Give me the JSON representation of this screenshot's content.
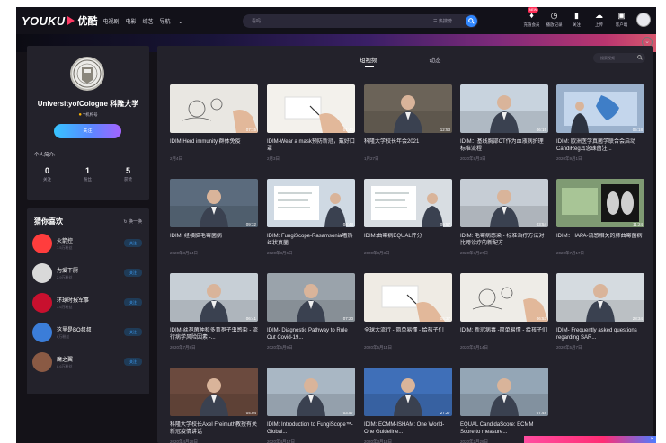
{
  "header": {
    "logo_text": "YOUKU",
    "logo_cn": "优酷",
    "nav": [
      "电视剧",
      "电影",
      "综艺",
      "导航"
    ],
    "search_placeholder": "看吗",
    "hot_label": "热搜榜",
    "icons": [
      {
        "icon": "vip-diamond-icon",
        "label": "充值会员",
        "badge": "NEW"
      },
      {
        "icon": "history-clock-icon",
        "label": "播放记录"
      },
      {
        "icon": "bookmark-icon",
        "label": "关注"
      },
      {
        "icon": "upload-cloud-icon",
        "label": "上传"
      },
      {
        "icon": "client-monitor-icon",
        "label": "客户端"
      }
    ]
  },
  "profile": {
    "name": "UniversityofCologne 科隆大学",
    "auth": "Y机构号",
    "follow_label": "关注",
    "intro_label": "个人简介:",
    "stats": [
      {
        "value": "0",
        "label": "关注"
      },
      {
        "value": "1",
        "label": "粉丝"
      },
      {
        "value": "5",
        "label": "获赞"
      }
    ]
  },
  "recommend": {
    "title": "猜你喜欢",
    "refresh": "换一换",
    "items": [
      {
        "name": "火箭控",
        "sub": "7.5万粉丝",
        "btn": "关注",
        "color": "#ff3d3d"
      },
      {
        "name": "为爱下厨",
        "sub": "2.9万粉丝",
        "btn": "关注",
        "color": "#d9d9d9"
      },
      {
        "name": "环球时报军事",
        "sub": "3.6万粉丝",
        "btn": "关注",
        "color": "#c8102e"
      },
      {
        "name": "这里是BO叔叔",
        "sub": "6万粉丝",
        "btn": "关注",
        "color": "#3b7dd8"
      },
      {
        "name": "魔之翼",
        "sub": "8.6万粉丝",
        "btn": "关注",
        "color": "#8a5a44"
      }
    ]
  },
  "main": {
    "tabs": [
      "短视频",
      "动态"
    ],
    "search_placeholder": "搜索视频",
    "videos": [
      {
        "title": "IDIM Herd immunity 群体免疫",
        "date": "2月4日",
        "dur": "07:15",
        "bg": "#e9e7e2",
        "kind": "drawing"
      },
      {
        "title": "IDIM-Wear a mask预防新冠，戴好口罩",
        "date": "2月3日",
        "dur": "01:40",
        "bg": "#f3f1ec",
        "kind": "hand"
      },
      {
        "title": "科隆大学校长年会2021",
        "date": "1月27日",
        "dur": "12:53",
        "bg": "#6b6358",
        "kind": "person"
      },
      {
        "title": "IDIM：基线胸部CT作为血液病护理标准流程",
        "date": "2020年9月3日",
        "dur": "06:15",
        "bg": "#c8d3de",
        "kind": "person"
      },
      {
        "title": "IDIM: 欧洲医学真菌学联合会启动CandiReg耳念珠菌注...",
        "date": "2020年9月1日",
        "dur": "05:18",
        "bg": "#9bb1cc",
        "kind": "map"
      },
      {
        "title": "IDIM: 经横脑毛霉菌病",
        "date": "2020年8月24日",
        "dur": "09:32",
        "bg": "#5b6b7d",
        "kind": "person"
      },
      {
        "title": "IDIM: FungiScope-Rasamsonia嗜热丝状真菌...",
        "date": "2020年8月6日",
        "dur": "04:48",
        "bg": "#cfd9e3",
        "kind": "slide"
      },
      {
        "title": "IDIM:曲霉病EQUAL评分",
        "date": "2020年8月3日",
        "dur": "09:57",
        "bg": "#d8dde2",
        "kind": "slide"
      },
      {
        "title": "IDIM: 毛霉病感染 - 标准治疗方法对比跨诊疗的新配方",
        "date": "2020年7月27日",
        "dur": "03:54",
        "bg": "#c6cdd5",
        "kind": "person"
      },
      {
        "title": "IDIM： IAPA-流感相关的肺曲霉菌病",
        "date": "2020年7月17日",
        "dur": "11:24",
        "bg": "#7f9a73",
        "kind": "scan"
      },
      {
        "title": "IDIM-丝孢菌种和多育孢子虫感染 - 流行病学风险因素 -...",
        "date": "2020年7月8日",
        "dur": "06:41",
        "bg": "#c7cfd6",
        "kind": "person"
      },
      {
        "title": "IDIM- Diagnostic Pathway to Rule Out Covid-19...",
        "date": "2020年6月9日",
        "dur": "07:20",
        "bg": "#9aa3ab",
        "kind": "person"
      },
      {
        "title": "全球大流行 - 简单易懂 - 给孩子们",
        "date": "2020年5月14日",
        "dur": "06:37",
        "bg": "#efebe4",
        "kind": "hand"
      },
      {
        "title": "IDIM: 新冠病毒 -简单易懂 - 给孩子们",
        "date": "2020年5月14日",
        "dur": "06:53",
        "bg": "#eeece7",
        "kind": "drawing"
      },
      {
        "title": "IDIM- Frequently asked questions regarding SAR...",
        "date": "2020年5月7日",
        "dur": "28:34",
        "bg": "#d5dbe0",
        "kind": "person"
      },
      {
        "title": "科隆大学校长Axel Freimuth教授有关新冠疫情讲话",
        "date": "2020年4月28日",
        "dur": "04:04",
        "bg": "#6b4a3e",
        "kind": "person"
      },
      {
        "title": "IDIM: Introduction to FungiScope™-Global...",
        "date": "2020年4月17日",
        "dur": "03:57",
        "bg": "#a9b7c4",
        "kind": "person"
      },
      {
        "title": "IDIM: ECMM-ISHAM: One World-One Guideline...",
        "date": "2020年3月13日",
        "dur": "27:27",
        "bg": "#3f6fb8",
        "kind": "person"
      },
      {
        "title": "EQUAL CandidaScore: ECMM Score to measure...",
        "date": "2020年2月26日",
        "dur": "07:48",
        "bg": "#94a6b6",
        "kind": "person"
      }
    ]
  },
  "promo_close": "×"
}
